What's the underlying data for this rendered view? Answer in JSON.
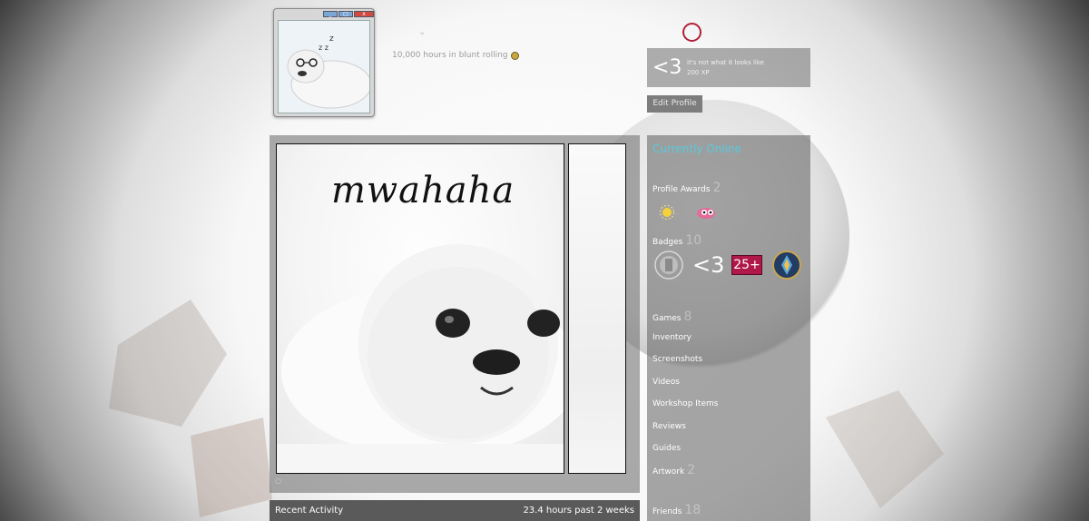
{
  "profile": {
    "real_name": "10,000 hours in blunt rolling",
    "caret": "⌄"
  },
  "featured_badge": {
    "icon_text": "<3",
    "name": "it's not what it looks like",
    "xp": "200 XP"
  },
  "edit_profile_label": "Edit Profile",
  "showcase": {
    "artwork_caption": "mwahaha",
    "dot": "○"
  },
  "recent_activity": {
    "label": "Recent Activity",
    "hours": "23.4 hours past 2 weeks"
  },
  "sidebar": {
    "status": "Currently Online",
    "awards": {
      "label": "Profile Awards",
      "count": "2"
    },
    "badges": {
      "label": "Badges",
      "count": "10",
      "items": [
        "medal-icon",
        "<3",
        "25+",
        "crest-icon"
      ]
    },
    "links": [
      {
        "label": "Games",
        "count": "8"
      },
      {
        "label": "Inventory",
        "count": ""
      },
      {
        "label": "Screenshots",
        "count": ""
      },
      {
        "label": "Videos",
        "count": ""
      },
      {
        "label": "Workshop Items",
        "count": ""
      },
      {
        "label": "Reviews",
        "count": ""
      },
      {
        "label": "Guides",
        "count": ""
      },
      {
        "label": "Artwork",
        "count": "2"
      }
    ],
    "friends": {
      "label": "Friends",
      "count": "18"
    }
  },
  "colors": {
    "online": "#57cbde",
    "level_ring": "#b0203a",
    "badge_25": "#b0184a"
  }
}
